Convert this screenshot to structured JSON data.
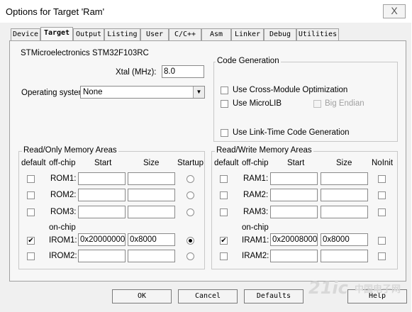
{
  "window": {
    "title": "Options for Target 'Ram'",
    "close_glyph": "X"
  },
  "tabs": [
    "Device",
    "Target",
    "Output",
    "Listing",
    "User",
    "C/C++",
    "Asm",
    "Linker",
    "Debug",
    "Utilities"
  ],
  "active_tab": "Target",
  "device_name": "STMicroelectronics STM32F103RC",
  "xtal": {
    "label": "Xtal (MHz):",
    "value": "8.0"
  },
  "os": {
    "label": "Operating system:",
    "value": "None"
  },
  "code_gen": {
    "title": "Code Generation",
    "cross_module": "Use Cross-Module Optimization",
    "microlib": "Use MicroLIB",
    "big_endian": "Big Endian",
    "ltcg": "Use Link-Time Code Generation"
  },
  "ro_memory": {
    "title": "Read/Only Memory Areas",
    "headers": {
      "default": "default",
      "offchip": "off-chip",
      "start": "Start",
      "size": "Size",
      "startup": "Startup"
    },
    "onchip_label": "on-chip",
    "rows": [
      {
        "name": "ROM1:",
        "start": "",
        "size": "",
        "default": false,
        "startup": false
      },
      {
        "name": "ROM2:",
        "start": "",
        "size": "",
        "default": false,
        "startup": false
      },
      {
        "name": "ROM3:",
        "start": "",
        "size": "",
        "default": false,
        "startup": false
      },
      {
        "name": "IROM1:",
        "start": "0x20000000",
        "size": "0x8000",
        "default": true,
        "startup": true
      },
      {
        "name": "IROM2:",
        "start": "",
        "size": "",
        "default": false,
        "startup": false
      }
    ]
  },
  "rw_memory": {
    "title": "Read/Write Memory Areas",
    "headers": {
      "default": "default",
      "offchip": "off-chip",
      "start": "Start",
      "size": "Size",
      "noinit": "NoInit"
    },
    "onchip_label": "on-chip",
    "rows": [
      {
        "name": "RAM1:",
        "start": "",
        "size": "",
        "default": false,
        "noinit": false
      },
      {
        "name": "RAM2:",
        "start": "",
        "size": "",
        "default": false,
        "noinit": false
      },
      {
        "name": "RAM3:",
        "start": "",
        "size": "",
        "default": false,
        "noinit": false
      },
      {
        "name": "IRAM1:",
        "start": "0x20008000",
        "size": "0x8000",
        "default": true,
        "noinit": false
      },
      {
        "name": "IRAM2:",
        "start": "",
        "size": "",
        "default": false,
        "noinit": false
      }
    ]
  },
  "buttons": {
    "ok": "OK",
    "cancel": "Cancel",
    "defaults": "Defaults",
    "help": "Help"
  },
  "watermark": {
    "site": "21ic",
    "cn": "中国电子网"
  },
  "check_glyph": "✔"
}
